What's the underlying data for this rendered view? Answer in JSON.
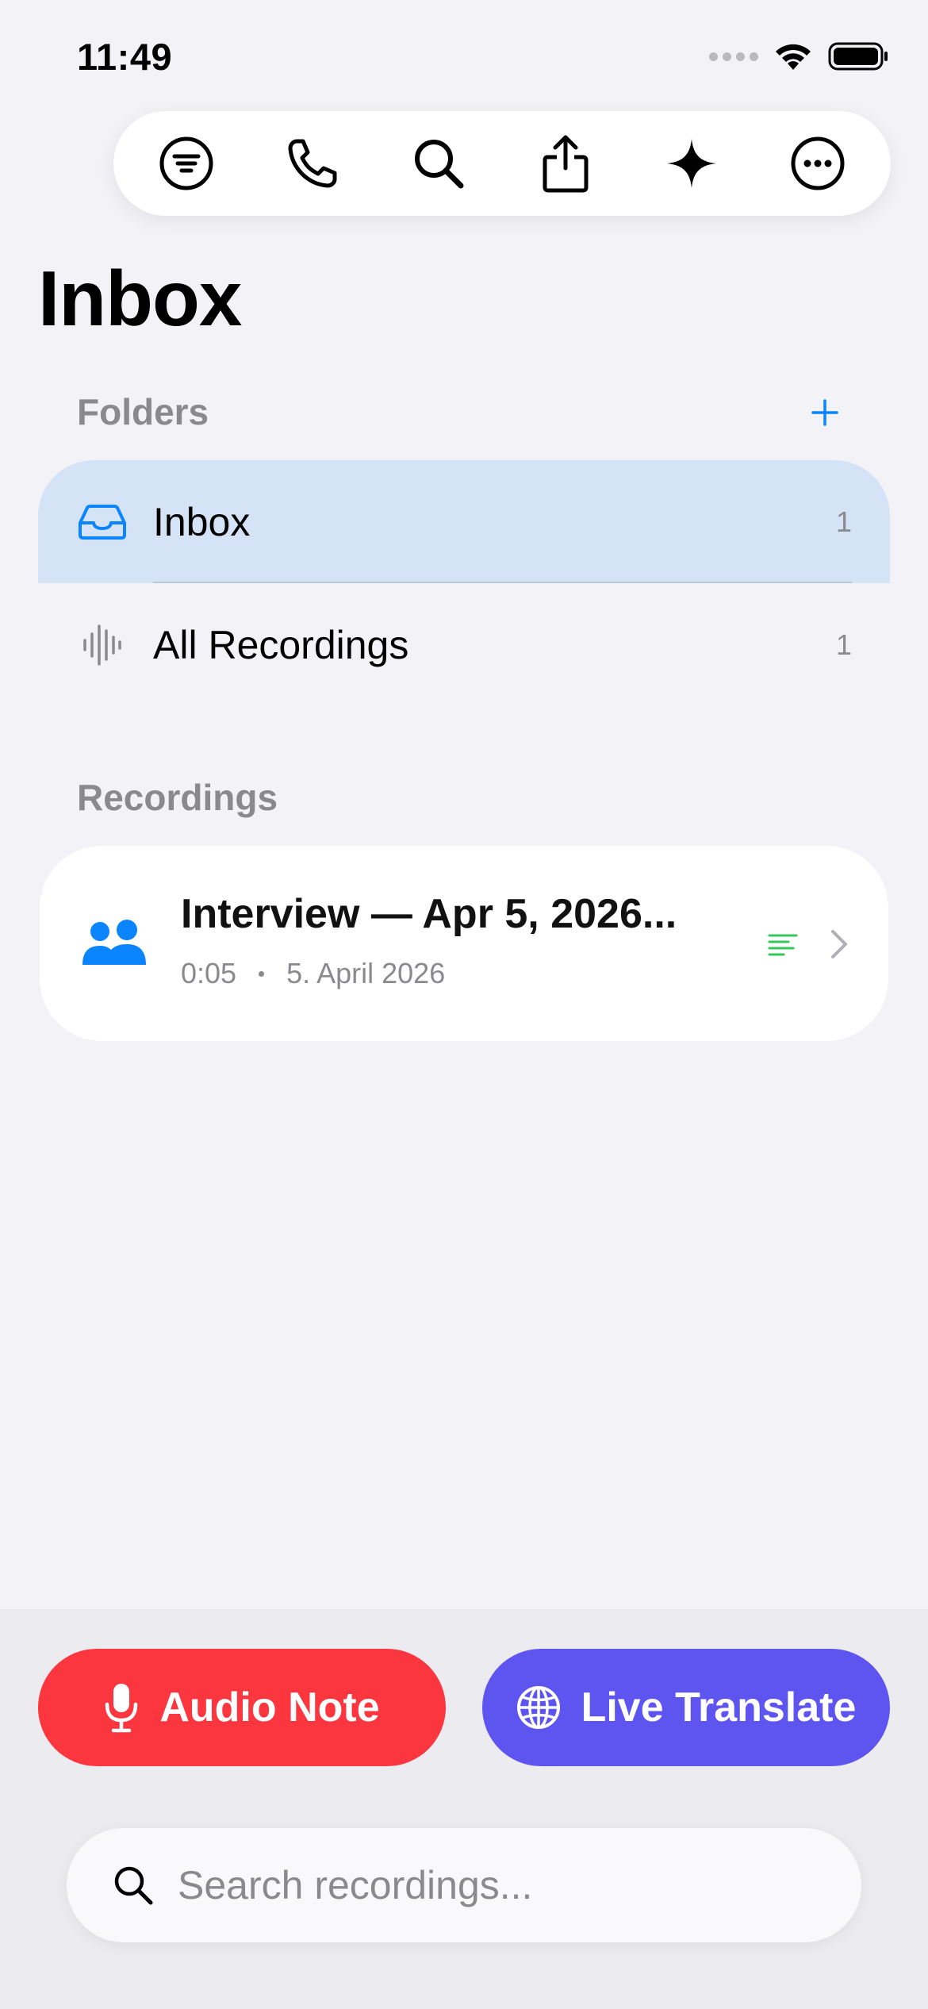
{
  "status_bar": {
    "time": "11:49"
  },
  "toolbar": {
    "buttons": [
      {
        "icon": "filter-icon"
      },
      {
        "icon": "phone-icon"
      },
      {
        "icon": "search-icon"
      },
      {
        "icon": "share-icon"
      },
      {
        "icon": "sparkle-icon"
      },
      {
        "icon": "more-icon"
      }
    ]
  },
  "page": {
    "title": "Inbox"
  },
  "folders": {
    "header": "Folders",
    "items": [
      {
        "label": "Inbox",
        "count": "1",
        "icon": "tray-icon",
        "selected": true
      },
      {
        "label": "All Recordings",
        "count": "1",
        "icon": "waveform-icon",
        "selected": false
      }
    ]
  },
  "recordings": {
    "header": "Recordings",
    "items": [
      {
        "title": "Interview — Apr 5, 2026...",
        "duration": "0:05",
        "date": "5. April 2026",
        "icon": "people-icon",
        "has_transcript": true
      }
    ]
  },
  "actions": {
    "audio_note": "Audio Note",
    "live_translate": "Live Translate"
  },
  "search": {
    "placeholder": "Search recordings...",
    "value": ""
  },
  "colors": {
    "accent_blue": "#0a84ff",
    "selected_row": "#d4e3f6",
    "audio_note_red": "#fc363f",
    "live_translate_purple": "#5e55f0",
    "transcript_green": "#34c759",
    "secondary_text": "#8a8a8e",
    "background": "#f2f2f7"
  }
}
